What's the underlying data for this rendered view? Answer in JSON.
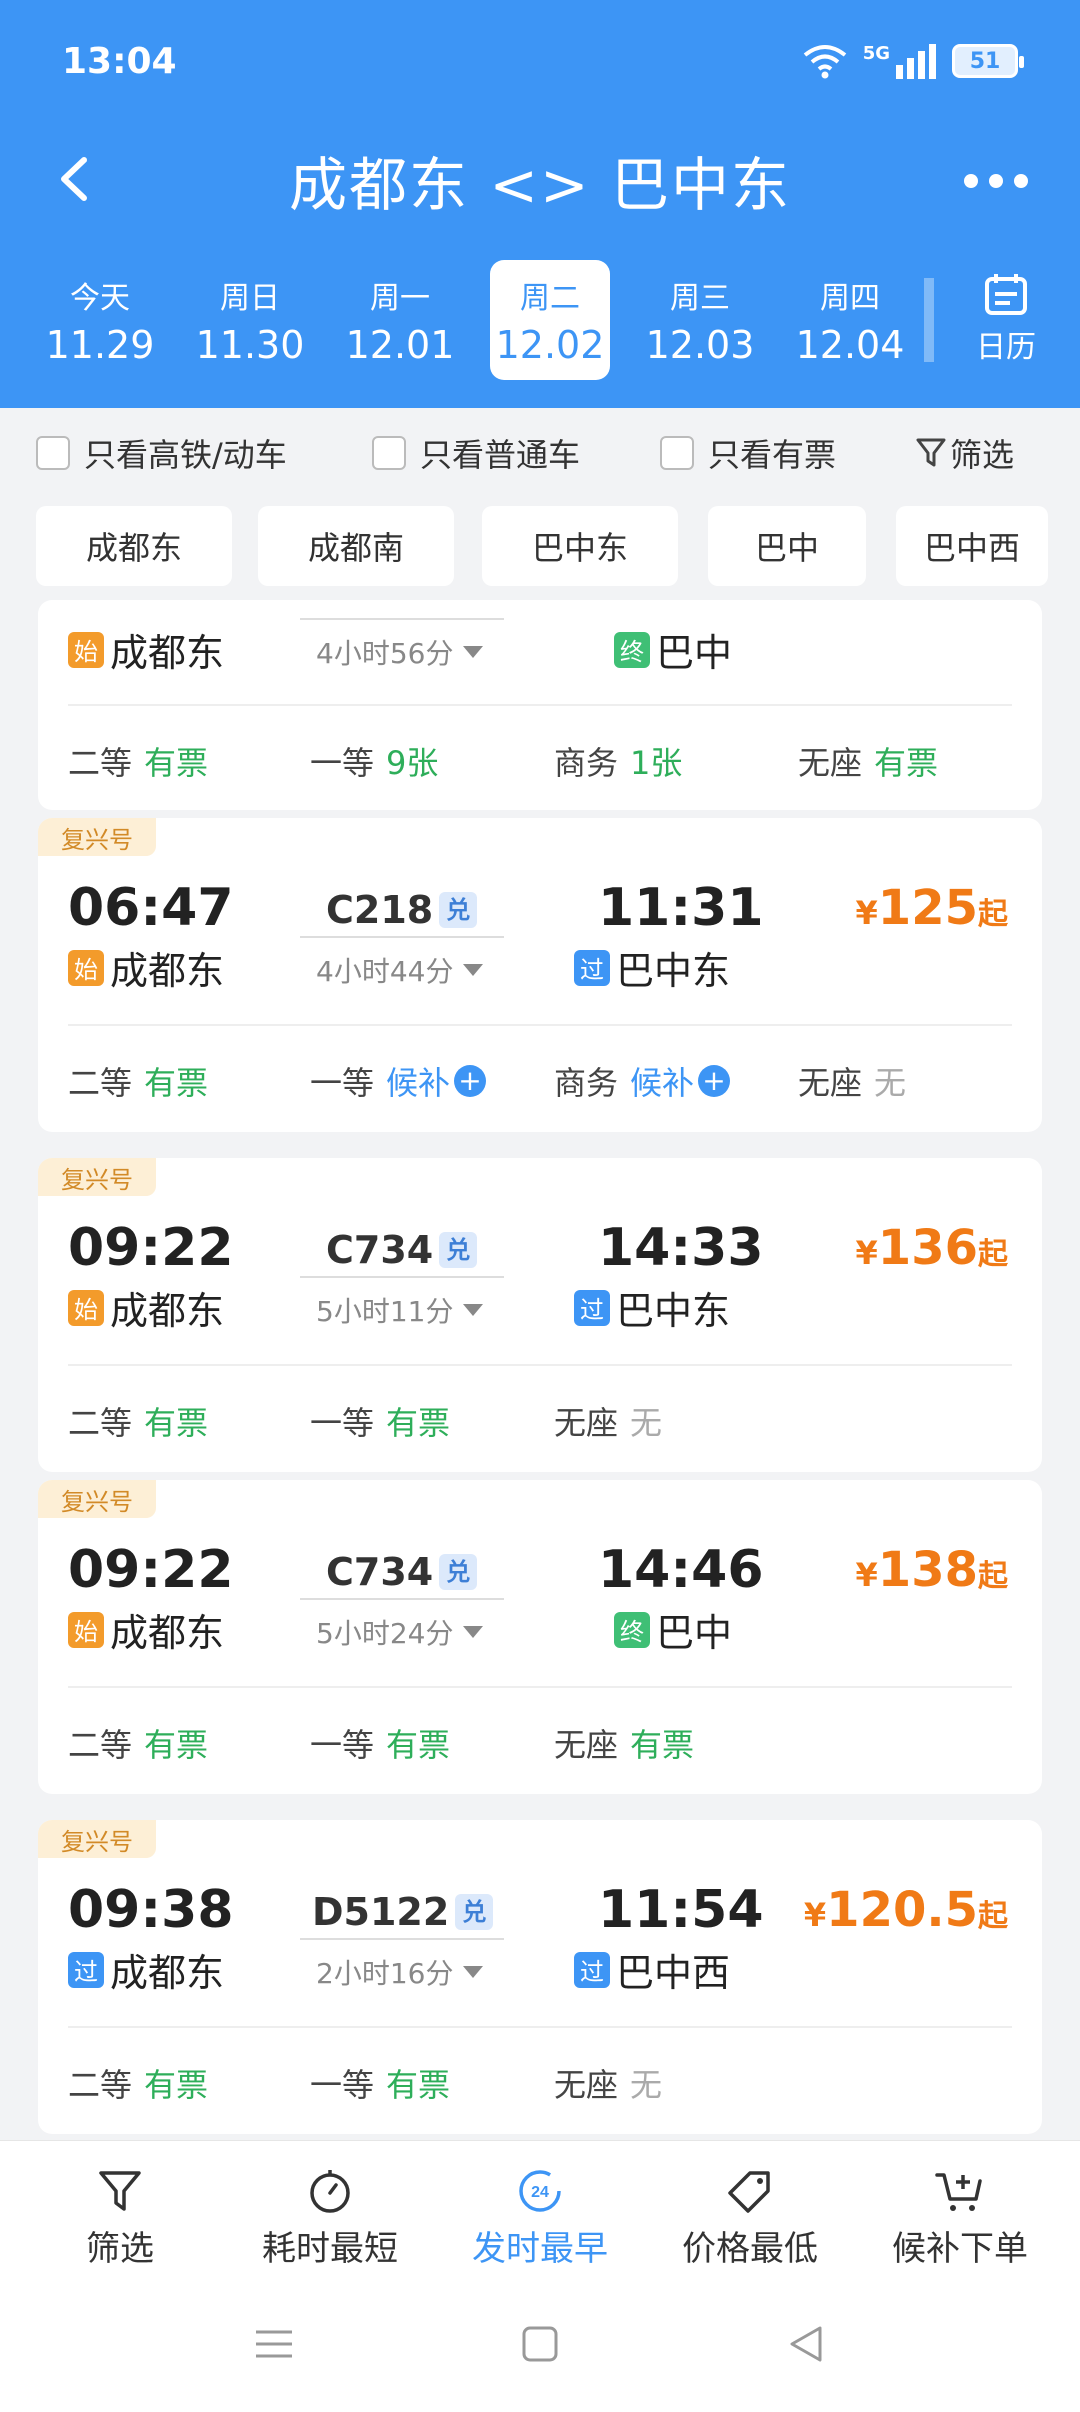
{
  "status": {
    "time": "13:04",
    "network": "5G",
    "battery": "51"
  },
  "header": {
    "title": "成都东 <> 巴中东"
  },
  "dates": [
    {
      "weekday": "今天",
      "date": "11.29"
    },
    {
      "weekday": "周日",
      "date": "11.30"
    },
    {
      "weekday": "周一",
      "date": "12.01"
    },
    {
      "weekday": "周二",
      "date": "12.02"
    },
    {
      "weekday": "周三",
      "date": "12.03"
    },
    {
      "weekday": "周四",
      "date": "12.04"
    }
  ],
  "calendar_label": "日历",
  "filters": {
    "high_speed": "只看高铁/动车",
    "normal": "只看普通车",
    "has_ticket": "只看有票",
    "screen": "筛选"
  },
  "stations": [
    "成都东",
    "成都南",
    "巴中东",
    "巴中",
    "巴中西"
  ],
  "trains": [
    {
      "from": "成都东",
      "from_tag": "始",
      "duration": "4小时56分",
      "to": "巴中",
      "to_tag": "终",
      "seats": [
        {
          "class": "二等",
          "status": "有票"
        },
        {
          "class": "一等",
          "status": "9张"
        },
        {
          "class": "商务",
          "status": "1张"
        },
        {
          "class": "无座",
          "status": "有票"
        }
      ]
    },
    {
      "badge": "复兴号",
      "dep": "06:47",
      "no": "C218",
      "dui": "兑",
      "arr": "11:31",
      "price_sym": "¥",
      "price": "125",
      "price_suffix": "起",
      "from": "成都东",
      "from_tag": "始",
      "duration": "4小时44分",
      "to": "巴中东",
      "to_tag": "过",
      "seats": [
        {
          "class": "二等",
          "status": "有票"
        },
        {
          "class": "一等",
          "status": "候补"
        },
        {
          "class": "商务",
          "status": "候补"
        },
        {
          "class": "无座",
          "status": "无"
        }
      ]
    },
    {
      "badge": "复兴号",
      "dep": "09:22",
      "no": "C734",
      "dui": "兑",
      "arr": "14:33",
      "price_sym": "¥",
      "price": "136",
      "price_suffix": "起",
      "from": "成都东",
      "from_tag": "始",
      "duration": "5小时11分",
      "to": "巴中东",
      "to_tag": "过",
      "seats": [
        {
          "class": "二等",
          "status": "有票"
        },
        {
          "class": "一等",
          "status": "有票"
        },
        {
          "class": "无座",
          "status": "无"
        }
      ]
    },
    {
      "badge": "复兴号",
      "dep": "09:22",
      "no": "C734",
      "dui": "兑",
      "arr": "14:46",
      "price_sym": "¥",
      "price": "138",
      "price_suffix": "起",
      "from": "成都东",
      "from_tag": "始",
      "duration": "5小时24分",
      "to": "巴中",
      "to_tag": "终",
      "seats": [
        {
          "class": "二等",
          "status": "有票"
        },
        {
          "class": "一等",
          "status": "有票"
        },
        {
          "class": "无座",
          "status": "有票"
        }
      ]
    },
    {
      "badge": "复兴号",
      "dep": "09:38",
      "no": "D5122",
      "dui": "兑",
      "arr": "11:54",
      "price_sym": "¥",
      "price": "120.5",
      "price_suffix": "起",
      "from": "成都东",
      "from_tag": "过",
      "duration": "2小时16分",
      "to": "巴中西",
      "to_tag": "过",
      "seats": [
        {
          "class": "二等",
          "status": "有票"
        },
        {
          "class": "一等",
          "status": "有票"
        },
        {
          "class": "无座",
          "status": "无"
        }
      ]
    }
  ],
  "bottom_tabs": [
    {
      "label": "筛选",
      "icon": "funnel-icon"
    },
    {
      "label": "耗时最短",
      "icon": "stopwatch-icon"
    },
    {
      "label": "发时最早",
      "icon": "clock-24-icon",
      "icon_text": "24"
    },
    {
      "label": "价格最低",
      "icon": "price-tag-icon"
    },
    {
      "label": "候补下单",
      "icon": "cart-plus-icon"
    }
  ],
  "colors": {
    "primary": "#3d95f5",
    "price": "#f07a16",
    "available": "#2eae5a"
  }
}
